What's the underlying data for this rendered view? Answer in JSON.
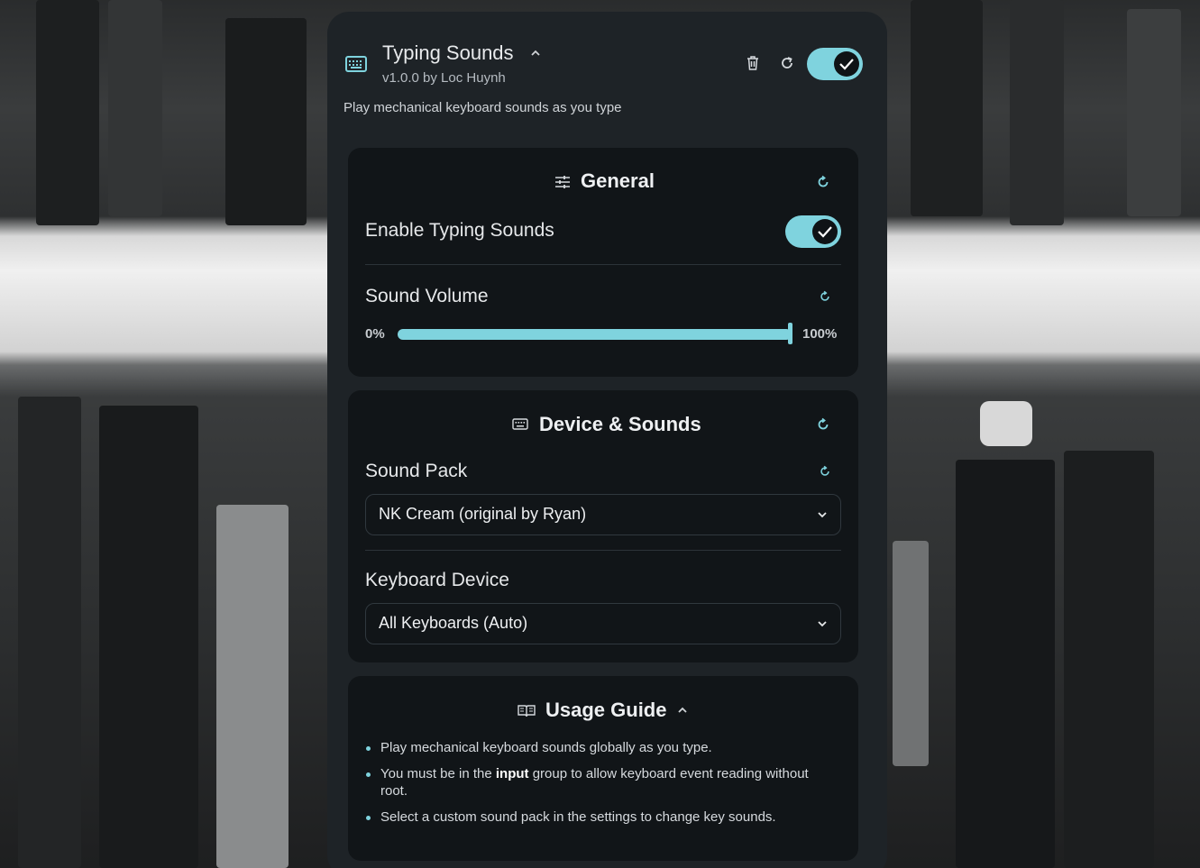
{
  "plugin": {
    "title": "Typing Sounds",
    "version": "v1.0.0 by Loc Huynh",
    "description": "Play mechanical keyboard sounds as you type",
    "enabled": true
  },
  "general": {
    "title": "General",
    "enable_label": "Enable Typing Sounds",
    "enable_value": true,
    "volume_label": "Sound Volume",
    "volume_min": "0%",
    "volume_max": "100%",
    "volume_value": 1.0
  },
  "device_sounds": {
    "title": "Device & Sounds",
    "sound_pack_label": "Sound Pack",
    "sound_pack_value": "NK Cream (original by Ryan)",
    "keyboard_device_label": "Keyboard Device",
    "keyboard_device_value": "All Keyboards (Auto)"
  },
  "usage_guide": {
    "title": "Usage Guide",
    "items": [
      {
        "text": "Play mechanical keyboard sounds globally as you type."
      },
      {
        "pre": "You must be in the ",
        "bold": "input",
        "post": " group to allow keyboard event reading without root."
      },
      {
        "text": "Select a custom sound pack in the settings to change key sounds."
      }
    ]
  },
  "colors": {
    "accent": "#7fd3de",
    "panel": "#1e2327",
    "card": "#111518"
  }
}
